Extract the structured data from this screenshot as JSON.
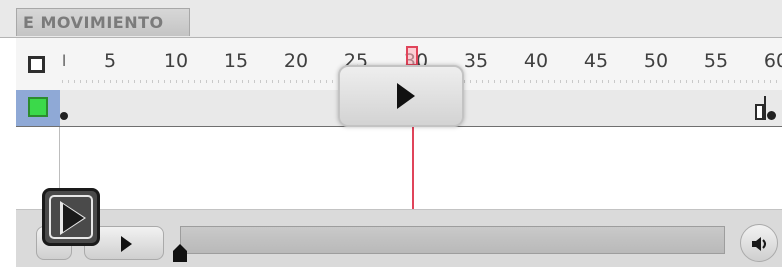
{
  "tab": {
    "label": "E MOVIMIENTO"
  },
  "ruler": {
    "first_label": "l",
    "labels": [
      "5",
      "10",
      "15",
      "20",
      "25",
      "30",
      "35",
      "40",
      "45",
      "50",
      "55",
      "60"
    ]
  },
  "timeline": {
    "current_frame": 30,
    "track_color": "#3bd94a"
  },
  "icons": {
    "big_play": "play-icon",
    "small_play": "play-icon",
    "volume": "speaker-icon",
    "overlay_play": "play-icon"
  }
}
